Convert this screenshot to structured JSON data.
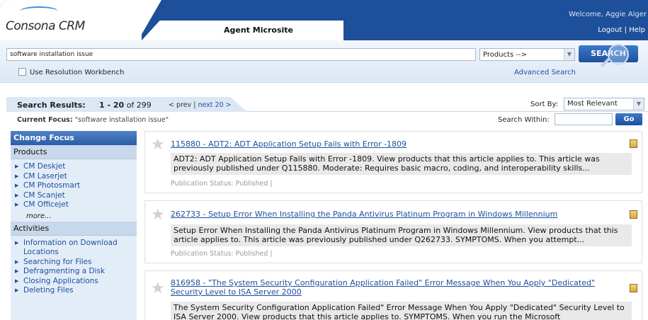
{
  "header": {
    "logo_text": "Consona CRM",
    "tab_title": "Agent Microsite",
    "welcome": "Welcome, Aggie Alger",
    "logout": "Logout",
    "separator": "|",
    "help": "Help"
  },
  "search": {
    "query": "software installation issue",
    "scope_selected": "Products -->",
    "button_label": "SEARCH",
    "workbench_label": "Use Resolution Workbench",
    "advanced_label": "Advanced Search"
  },
  "results_bar": {
    "title": "Search Results:",
    "range": "1 - 20",
    "of": "of 299",
    "prev": "< prev",
    "sep": "|",
    "next": "next 20 >",
    "sort_label": "Sort By:",
    "sort_value": "Most Relevant",
    "focus_label": "Current Focus:",
    "focus_value": "\"software installation issue\"",
    "within_label": "Search Within:",
    "go_label": "Go"
  },
  "sidebar": {
    "head": "Change Focus",
    "products_title": "Products",
    "products": [
      "CM Deskjet",
      "CM Laserjet",
      "CM Photosmart",
      "CM Scanjet",
      "CM Officejet"
    ],
    "more": "more...",
    "activities_title": "Activities",
    "activities": [
      "Information on Download Locations",
      "Searching for Files",
      "Defragmenting a Disk",
      "Closing Applications",
      "Deleting Files"
    ]
  },
  "results": [
    {
      "title": "115880 - ADT2: ADT Application Setup Fails with Error -1809",
      "snippet": "ADT2: ADT Application Setup Fails with Error -1809. View products that this article applies to. This article was previously published under Q115880. Moderate: Requires basic macro, coding, and interoperability skills...",
      "status": "Publication Status: Published |"
    },
    {
      "title": "262733 - Setup Error When Installing the Panda Antivirus Platinum Program in Windows Millennium",
      "snippet": "Setup Error When Installing the Panda Antivirus Platinum Program in Windows Millennium. View products that this article applies to. This article was previously published under Q262733. SYMPTOMS. When you attempt...",
      "status": "Publication Status: Published |"
    },
    {
      "title": "816958 - \"The System Security Configuration Application Failed\" Error Message When You Apply \"Dedicated\" Security Level to ISA Server 2000",
      "snippet": "The System Security Configuration Application Failed\" Error Message When You Apply \"Dedicated\" Security Level to ISA Server 2000. View products that this article applies to. SYMPTOMS. When you run the Microsoft",
      "status": ""
    }
  ],
  "colors": {
    "header_blue": "#1d4f9a",
    "link_blue": "#1c4f9c",
    "sidebar_bg": "#e3edf8"
  }
}
